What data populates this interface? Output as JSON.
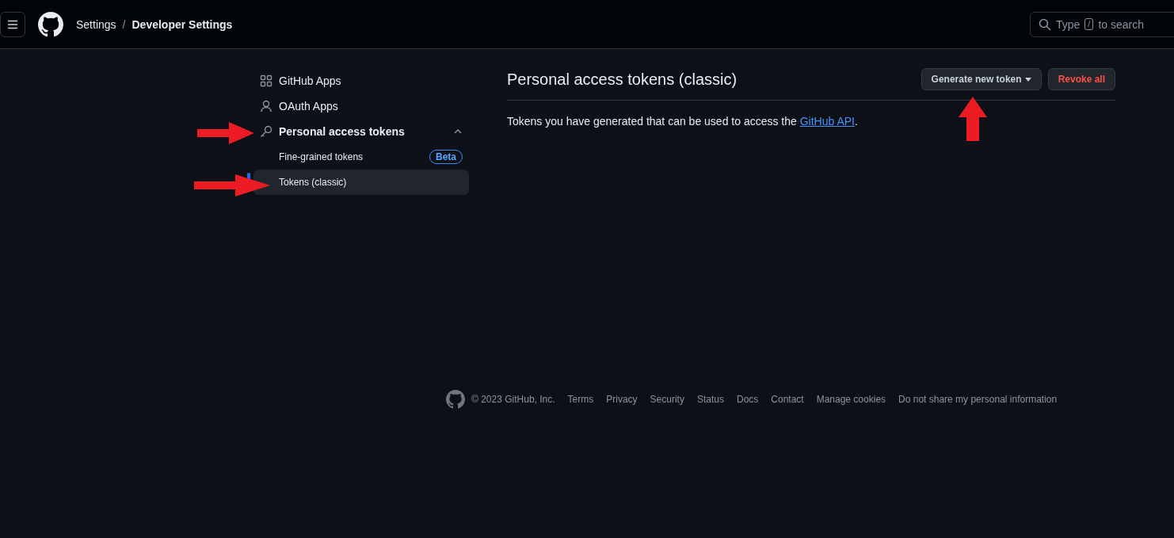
{
  "header": {
    "breadcrumb": [
      "Settings",
      "Developer Settings"
    ],
    "separator": "/",
    "search": {
      "before": "Type",
      "key": "/",
      "after": "to search"
    }
  },
  "sidebar": {
    "items": [
      {
        "label": "GitHub Apps",
        "expanded": false
      },
      {
        "label": "OAuth Apps",
        "expanded": false
      },
      {
        "label": "Personal access tokens",
        "expanded": true,
        "children": [
          {
            "label": "Fine-grained tokens",
            "badge": "Beta",
            "selected": false
          },
          {
            "label": "Tokens (classic)",
            "selected": true
          }
        ]
      }
    ]
  },
  "main": {
    "title": "Personal access tokens (classic)",
    "buttons": [
      {
        "label": "Generate new token",
        "kind": "dropdown"
      },
      {
        "label": "Revoke all",
        "kind": "danger"
      }
    ],
    "description": {
      "before": "Tokens you have generated that can be used to access the ",
      "link": "GitHub API",
      "after": "."
    }
  },
  "footer": {
    "copyright": "© 2023 GitHub, Inc.",
    "links": [
      "Terms",
      "Privacy",
      "Security",
      "Status",
      "Docs",
      "Contact",
      "Manage cookies",
      "Do not share my personal information"
    ]
  }
}
